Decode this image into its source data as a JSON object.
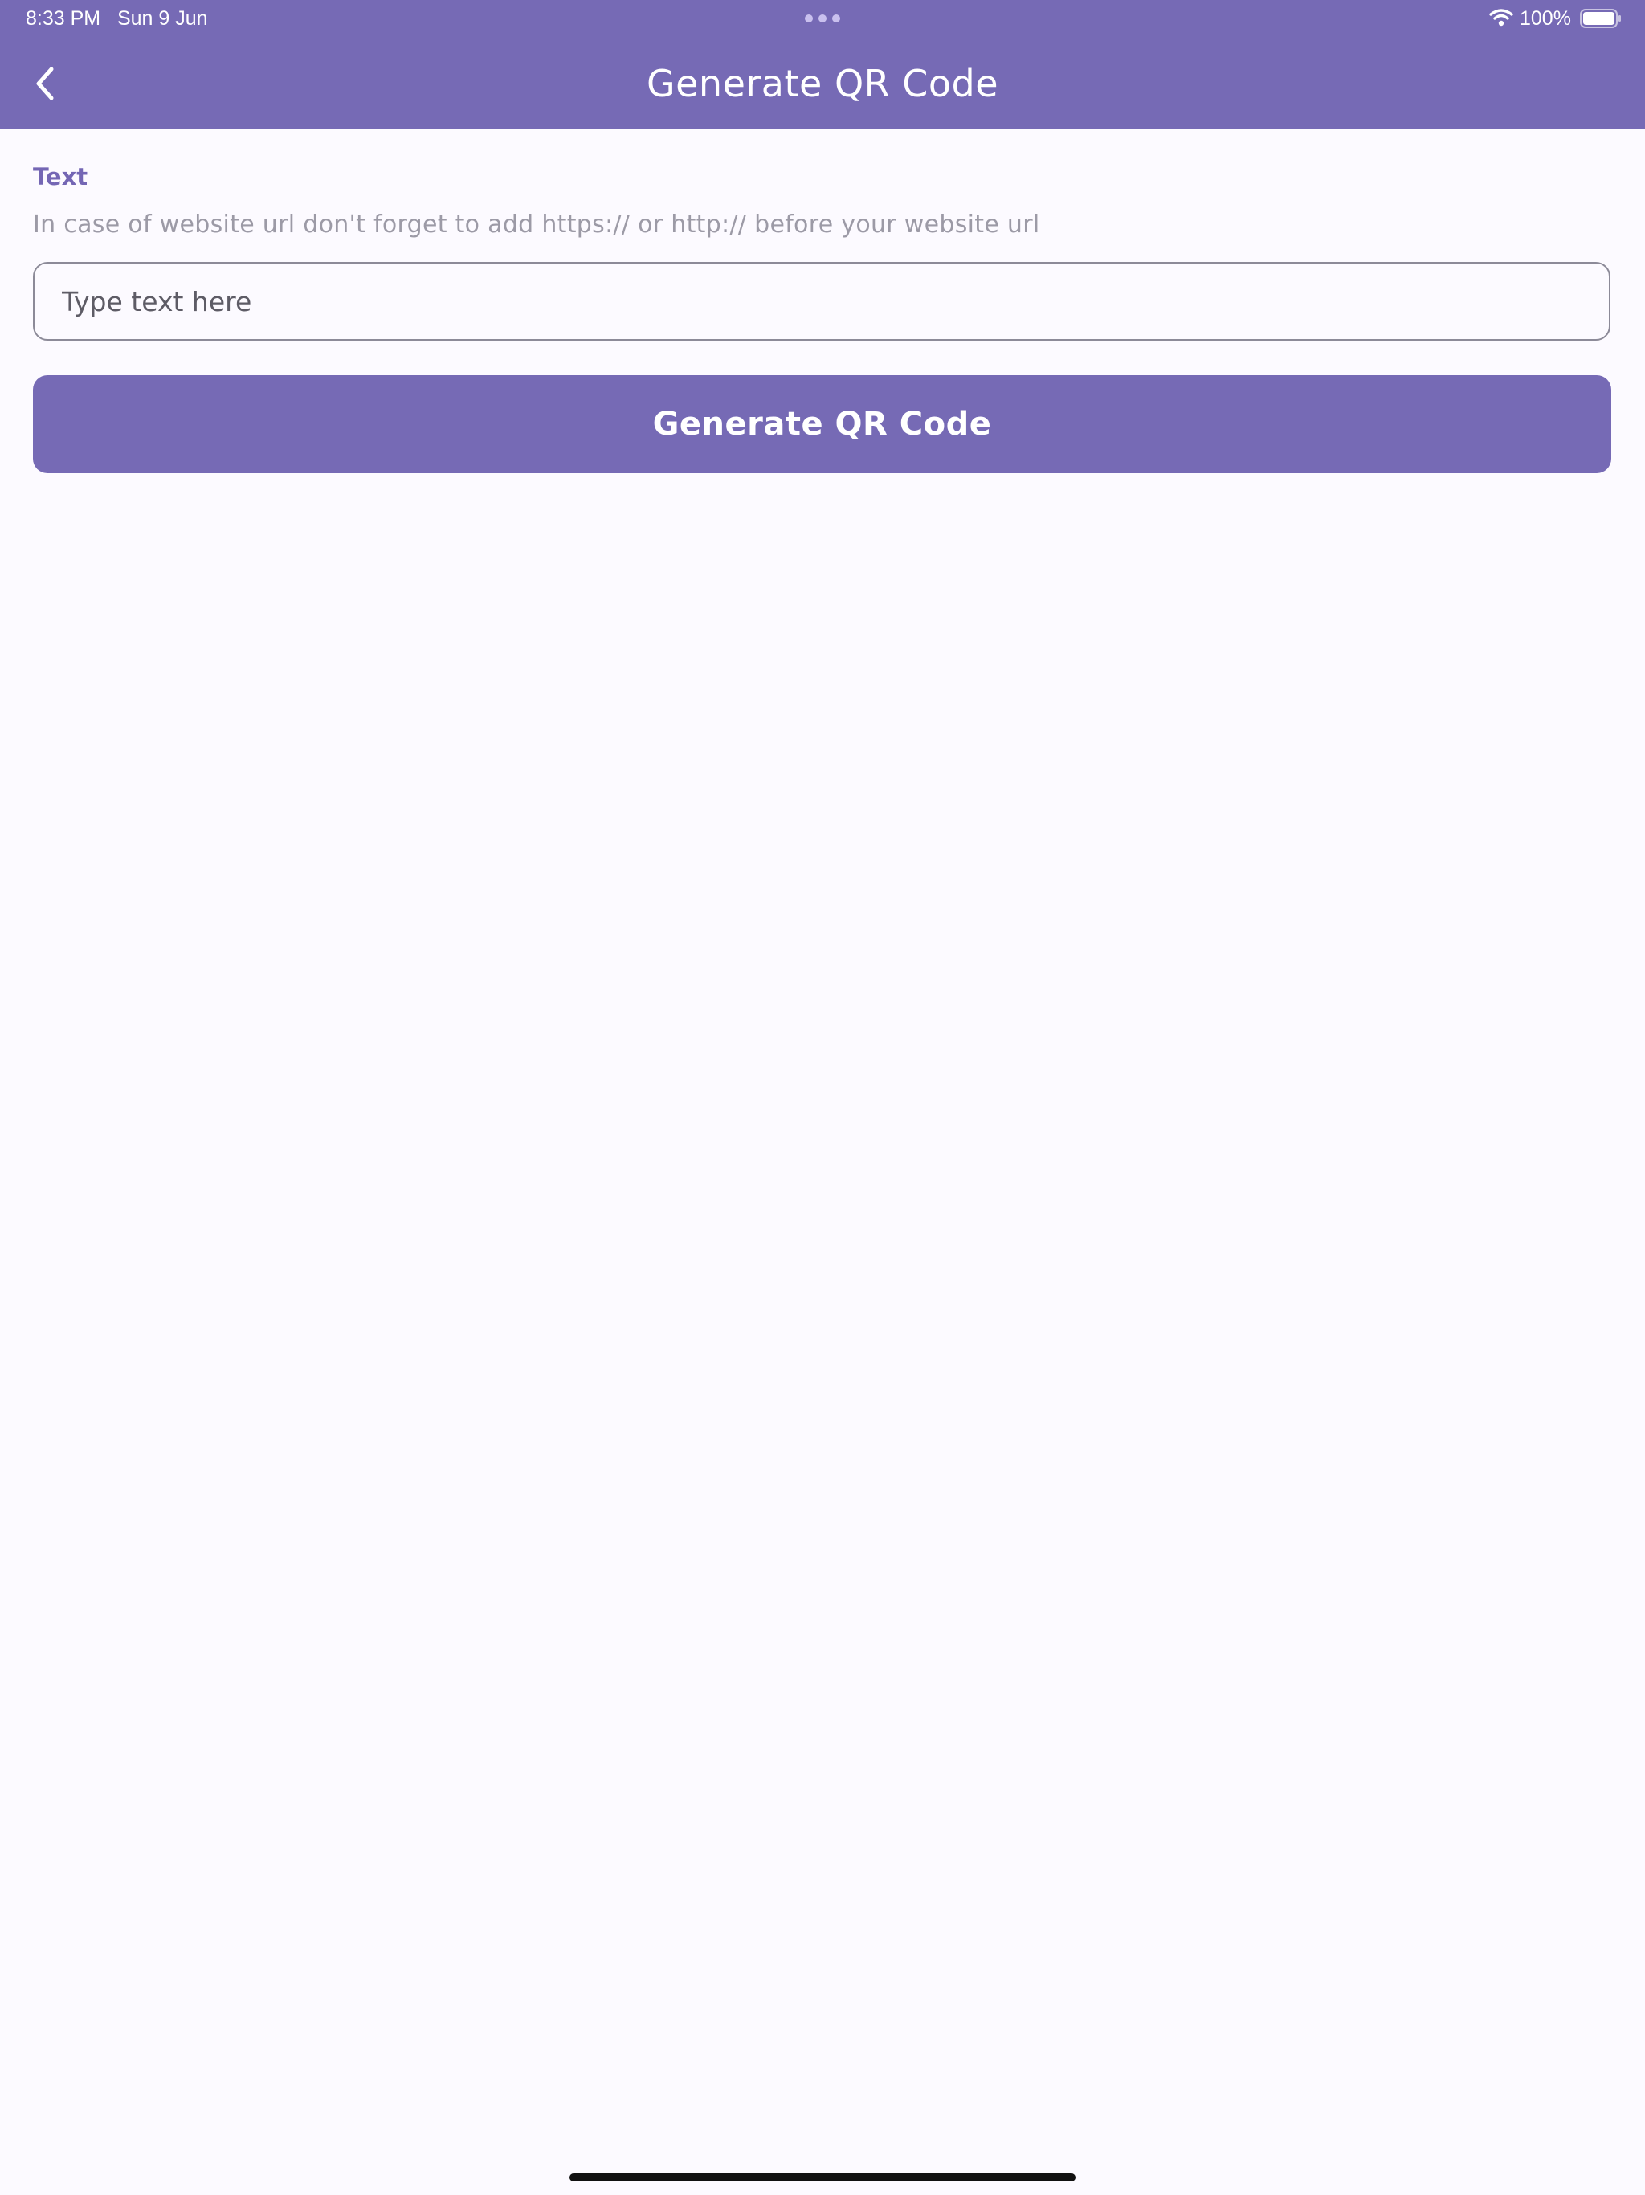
{
  "status_bar": {
    "time": "8:33 PM",
    "date": "Sun 9 Jun",
    "battery": "100%",
    "icons": [
      "wifi-icon",
      "battery-icon",
      "multitasking-dots-icon"
    ]
  },
  "nav": {
    "title": "Generate QR Code",
    "back_icon": "chevron-left-icon"
  },
  "form": {
    "label": "Text",
    "hint": "In case of website url don't forget to add https:// or http:// before your website url",
    "input_value": "",
    "input_placeholder": "Type text here",
    "button_label": "Generate QR Code"
  },
  "colors": {
    "primary": "#766ab5",
    "label": "#7466b4",
    "hint": "#9c9aa6",
    "background": "#fcfaff"
  }
}
